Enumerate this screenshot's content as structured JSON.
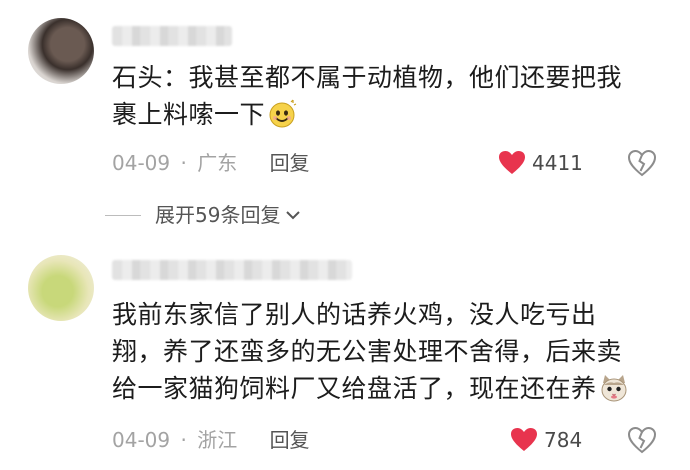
{
  "comments": [
    {
      "text": "石头：我甚至都不属于动植物，他们还要把我裹上料嗦一下",
      "emoji": "smile-emoji",
      "date": "04-09",
      "location": "广东",
      "reply_label": "回复",
      "likes": "4411"
    },
    {
      "text": "我前东家信了别人的话养火鸡，没人吃亏出翔，养了还蛮多的无公害处理不舍得，后来卖给一家猫狗饲料厂又给盘活了，现在还在养",
      "emoji": "cat-emoji",
      "date": "04-09",
      "location": "浙江",
      "reply_label": "回复",
      "likes": "784"
    }
  ],
  "expand_replies": "展开59条回复",
  "meta_separator": "·",
  "colors": {
    "heart": "#e8344e",
    "meta": "#a3a3a3",
    "text": "#1c1c1c"
  }
}
